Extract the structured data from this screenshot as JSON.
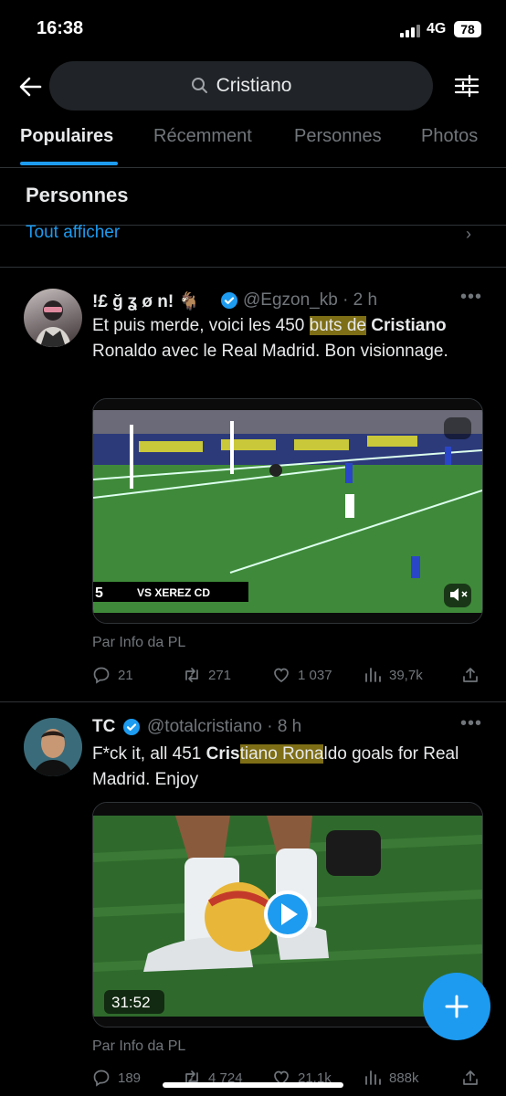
{
  "status": {
    "time": "16:38",
    "network": "4G",
    "battery": "78"
  },
  "search": {
    "query": "Cristiano"
  },
  "tabs": [
    {
      "label": "Populaires",
      "active": true
    },
    {
      "label": "Récemment",
      "active": false
    },
    {
      "label": "Personnes",
      "active": false
    },
    {
      "label": "Photos",
      "active": false
    }
  ],
  "people_section": {
    "title": "Personnes",
    "see_all": "Tout afficher"
  },
  "tweets": [
    {
      "name": "!£ ğ ʓ ø n! 🐐",
      "handle": "@Egzon_kb",
      "time": "· 2 h",
      "text_parts": [
        "Et puis merde, voici les 450 ",
        "buts de",
        " ",
        "Cristiano",
        " Ronaldo avec le Real Madrid. Bon visionnage."
      ],
      "video_overlay": "VS XEREZ CD",
      "video_number": "5",
      "source": "Par Info da PL",
      "stats": {
        "replies": "21",
        "retweets": "271",
        "likes": "1 037",
        "views": "39,7k"
      }
    },
    {
      "name": "TC",
      "handle": "@totalcristiano",
      "time": "· 8 h",
      "text_parts": [
        "F*ck it, all 451 ",
        "Cris",
        "tiano Rona",
        "ldo goals for Real Madrid. Enjoy"
      ],
      "video_duration": "31:52",
      "source": "Par Info da PL",
      "stats": {
        "replies": "189",
        "retweets": "4 724",
        "likes": "21,1k",
        "views": "888k"
      }
    }
  ],
  "colors": {
    "accent": "#1d9bf0",
    "background": "#000000",
    "muted": "#71767b",
    "highlight": "#e6c828"
  },
  "icons": [
    "back-arrow-icon",
    "search-icon",
    "filter-icon",
    "verified-icon",
    "more-icon",
    "reply-icon",
    "retweet-icon",
    "like-icon",
    "views-icon",
    "share-icon",
    "mute-icon",
    "play-icon",
    "compose-icon"
  ]
}
